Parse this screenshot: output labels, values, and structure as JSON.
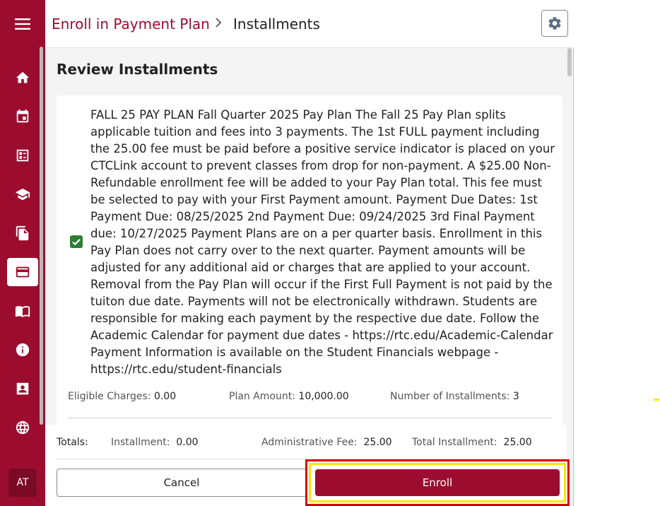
{
  "header": {
    "breadcrumb_link": "Enroll in Payment Plan",
    "breadcrumb_current": "Installments"
  },
  "sidebar": {
    "items": [
      {
        "icon": "home-icon"
      },
      {
        "icon": "calendar-icon"
      },
      {
        "icon": "list-icon"
      },
      {
        "icon": "graduation-cap-icon"
      },
      {
        "icon": "documents-icon"
      },
      {
        "icon": "credit-card-icon",
        "active": true
      },
      {
        "icon": "newspaper-icon"
      },
      {
        "icon": "info-icon"
      },
      {
        "icon": "contact-card-icon"
      },
      {
        "icon": "globe-icon"
      }
    ],
    "avatar": "AT"
  },
  "main": {
    "section_title": "Review Installments",
    "plan": {
      "checked": true,
      "description": "FALL 25 PAY PLAN Fall Quarter 2025 Pay Plan The Fall 25 Pay Plan splits applicable tuition and fees into 3 payments. The 1st FULL payment including the 25.00 fee must be paid before a positive service indicator is placed on your CTCLink account to prevent classes from drop for non-payment. A $25.00 Non-Refundable enrollment fee will be added to your Pay Plan total. This fee must be selected to pay with your First Payment amount. Payment Due Dates: 1st Payment Due: 08/25/2025 2nd Payment Due: 09/24/2025 3rd Final Payment due: 10/27/2025 Payment Plans are on a per quarter basis. Enrollment in this Pay Plan does not carry over to the next quarter. Payment amounts will be adjusted for any additional aid or charges that are applied to your account. Removal from the Pay Plan will occur if the First Full Payment is not paid by the tuiton due date. Payments will not be electronically withdrawn. Students are responsible for making each payment by the respective due date. Follow the Academic Calendar for payment due dates - https://rtc.edu/Academic-Calendar Payment Information is available on the Student Financials webpage - https://rtc.edu/student-financials",
      "eligible_charges_label": "Eligible Charges:",
      "eligible_charges_value": "0.00",
      "plan_amount_label": "Plan Amount:",
      "plan_amount_value": "10,000.00",
      "installments_label": "Number of Installments:",
      "installments_value": "3"
    },
    "totals": {
      "label": "Totals:",
      "installment_label": "Installment:",
      "installment_value": "0.00",
      "admin_fee_label": "Administrative Fee:",
      "admin_fee_value": "25.00",
      "total_installment_label": "Total Installment:",
      "total_installment_value": "25.00"
    },
    "buttons": {
      "cancel": "Cancel",
      "enroll": "Enroll"
    }
  },
  "colors": {
    "brand": "#9c0c2f",
    "check": "#2e7d32",
    "highlight_outer": "#d80000",
    "highlight_inner": "#ffe500"
  }
}
